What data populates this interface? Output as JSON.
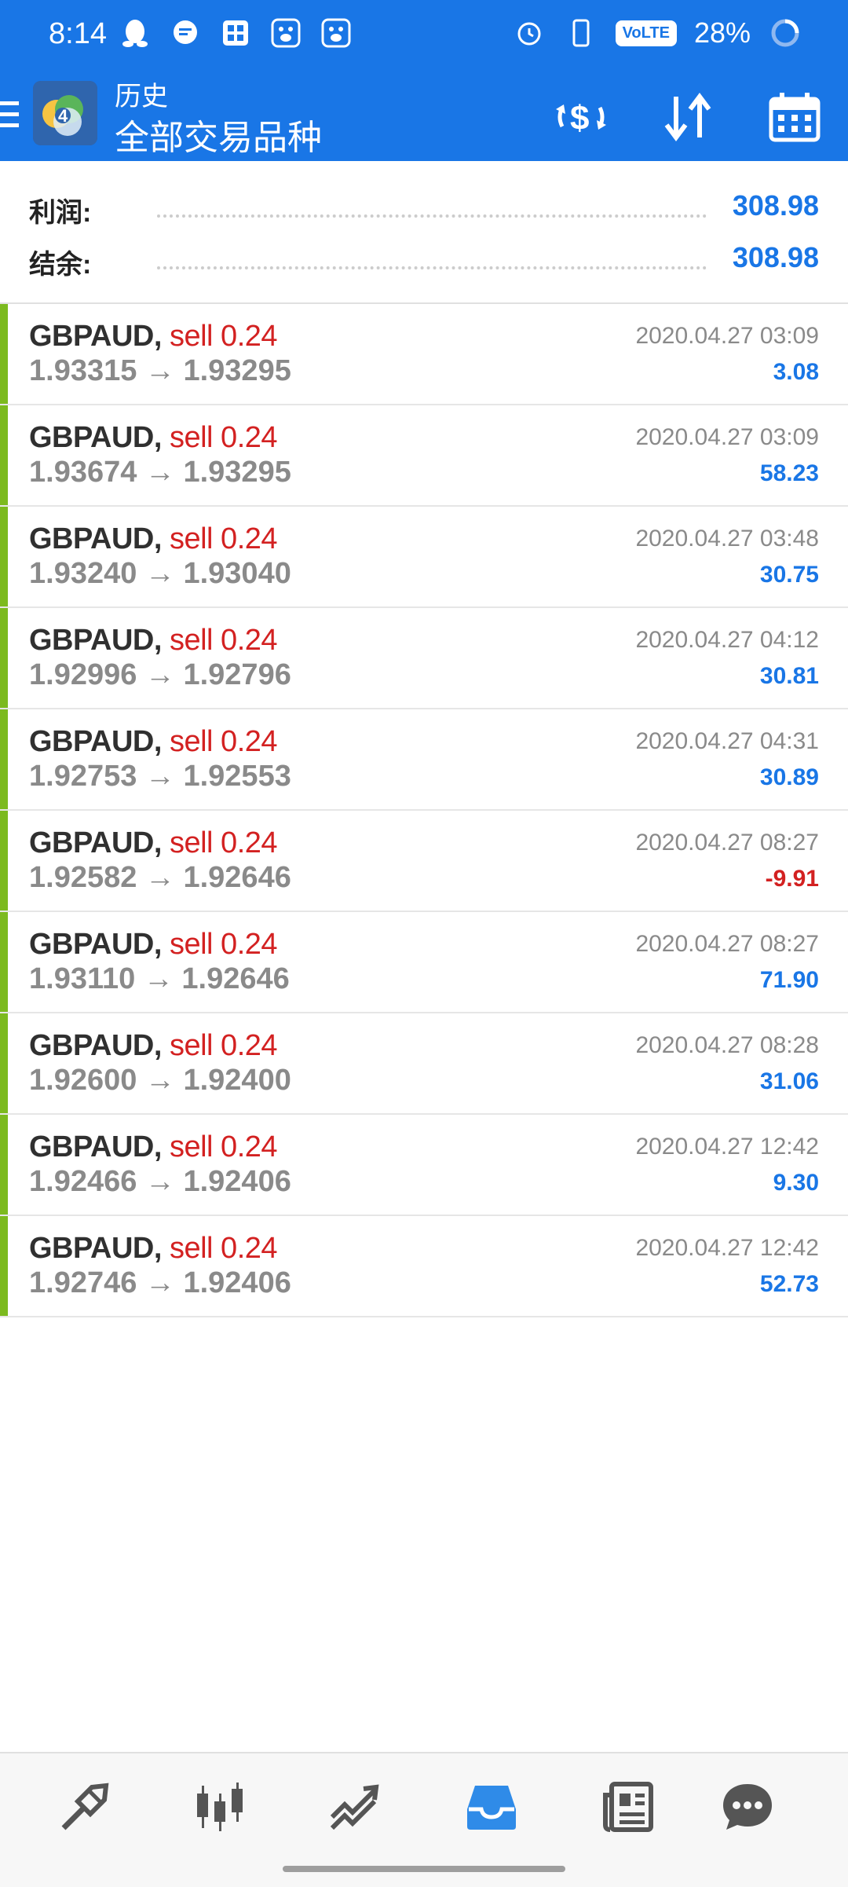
{
  "status_bar": {
    "time": "8:14",
    "battery": "28%",
    "volte": "VoLTE"
  },
  "toolbar": {
    "title": "历史",
    "subtitle": "全部交易品种"
  },
  "summary": {
    "profit_label": "利润:",
    "profit_value": "308.98",
    "balance_label": "结余:",
    "balance_value": "308.98"
  },
  "trades": [
    {
      "symbol": "GBPAUD,",
      "side": "sell 0.24",
      "prices": "1.93315 → 1.93295",
      "time": "2020.04.27 03:09",
      "profit": "3.08"
    },
    {
      "symbol": "GBPAUD,",
      "side": "sell 0.24",
      "prices": "1.93674 → 1.93295",
      "time": "2020.04.27 03:09",
      "profit": "58.23"
    },
    {
      "symbol": "GBPAUD,",
      "side": "sell 0.24",
      "prices": "1.93240 → 1.93040",
      "time": "2020.04.27 03:48",
      "profit": "30.75"
    },
    {
      "symbol": "GBPAUD,",
      "side": "sell 0.24",
      "prices": "1.92996 → 1.92796",
      "time": "2020.04.27 04:12",
      "profit": "30.81"
    },
    {
      "symbol": "GBPAUD,",
      "side": "sell 0.24",
      "prices": "1.92753 → 1.92553",
      "time": "2020.04.27 04:31",
      "profit": "30.89"
    },
    {
      "symbol": "GBPAUD,",
      "side": "sell 0.24",
      "prices": "1.92582 → 1.92646",
      "time": "2020.04.27 08:27",
      "profit": "-9.91"
    },
    {
      "symbol": "GBPAUD,",
      "side": "sell 0.24",
      "prices": "1.93110 → 1.92646",
      "time": "2020.04.27 08:27",
      "profit": "71.90"
    },
    {
      "symbol": "GBPAUD,",
      "side": "sell 0.24",
      "prices": "1.92600 → 1.92400",
      "time": "2020.04.27 08:28",
      "profit": "31.06"
    },
    {
      "symbol": "GBPAUD,",
      "side": "sell 0.24",
      "prices": "1.92466 → 1.92406",
      "time": "2020.04.27 12:42",
      "profit": "9.30"
    },
    {
      "symbol": "GBPAUD,",
      "side": "sell 0.24",
      "prices": "1.92746 → 1.92406",
      "time": "2020.04.27 12:42",
      "profit": "52.73"
    }
  ],
  "icons": {
    "toolbar": [
      "currency-exchange-icon",
      "sort-icon",
      "calendar-icon"
    ],
    "bottom_nav": [
      "quotes-icon",
      "chart-icon",
      "trade-icon",
      "history-icon",
      "news-icon",
      "chat-icon"
    ]
  },
  "colors": {
    "accent": "#1976e6",
    "sell": "#d32121",
    "profit_bar": "#7cba1f",
    "negative": "#d32121"
  }
}
